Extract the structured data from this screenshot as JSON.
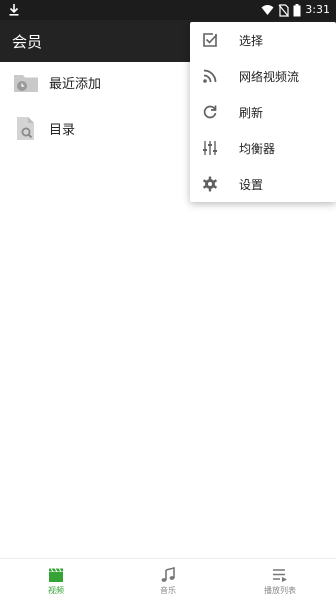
{
  "status_bar": {
    "time": "3:31",
    "icons": [
      "download-icon",
      "wifi-icon",
      "no-sim-icon",
      "battery-icon"
    ]
  },
  "app_bar": {
    "title": "会员"
  },
  "list": [
    {
      "label": "最近添加",
      "icon": "folder-clock-icon"
    },
    {
      "label": "目录",
      "icon": "file-search-icon"
    }
  ],
  "menu": {
    "items": [
      {
        "label": "选择",
        "icon": "checkbox-icon"
      },
      {
        "label": "网络视频流",
        "icon": "rss-icon"
      },
      {
        "label": "刷新",
        "icon": "refresh-icon"
      },
      {
        "label": "均衡器",
        "icon": "equalizer-icon"
      },
      {
        "label": "设置",
        "icon": "gear-icon"
      }
    ]
  },
  "bottom_nav": {
    "items": [
      {
        "label": "视频",
        "icon": "clapperboard-icon",
        "active": true
      },
      {
        "label": "音乐",
        "icon": "music-note-icon",
        "active": false
      },
      {
        "label": "播放列表",
        "icon": "playlist-icon",
        "active": false
      }
    ]
  },
  "colors": {
    "status_bar": "#1c1c1c",
    "app_bar": "#232323",
    "accent": "#35a435",
    "icon_gray": "#616161"
  }
}
